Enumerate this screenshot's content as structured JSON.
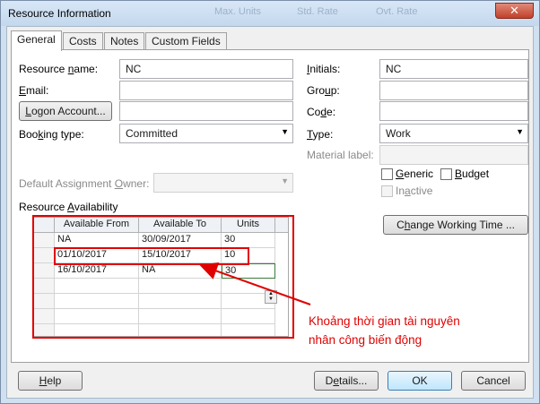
{
  "window": {
    "title": "Resource Information",
    "close_glyph": "✕",
    "background_texts": [
      "Max. Units",
      "Std. Rate",
      "Ovt. Rate"
    ]
  },
  "tabs": [
    {
      "label": "General",
      "active": true
    },
    {
      "label": "Costs",
      "active": false
    },
    {
      "label": "Notes",
      "active": false
    },
    {
      "label": "Custom Fields",
      "active": false
    }
  ],
  "left": {
    "resource_name": {
      "label_pre": "Resource ",
      "label_u": "n",
      "label_post": "ame:",
      "value": "NC"
    },
    "email": {
      "label_pre": "",
      "label_u": "E",
      "label_post": "mail:",
      "value": ""
    },
    "logon_button": {
      "label_pre": "",
      "label_u": "L",
      "label_post": "ogon Account..."
    },
    "logon_value": "",
    "booking": {
      "label_pre": "Boo",
      "label_u": "k",
      "label_post": "ing type:",
      "value": "Committed"
    },
    "default_owner": {
      "label_pre": "Default Assignment ",
      "label_u": "O",
      "label_post": "wner:",
      "value": ""
    }
  },
  "right": {
    "initials": {
      "label_pre": "",
      "label_u": "I",
      "label_post": "nitials:",
      "value": "NC"
    },
    "group": {
      "label_pre": "Gro",
      "label_u": "u",
      "label_post": "p:",
      "value": ""
    },
    "code": {
      "label_pre": "Co",
      "label_u": "d",
      "label_post": "e:",
      "value": ""
    },
    "type": {
      "label_pre": "",
      "label_u": "T",
      "label_post": "ype:",
      "value": "Work"
    },
    "material_label": {
      "label": "Material label:",
      "value": ""
    },
    "generic": {
      "label_pre": "",
      "label_u": "G",
      "label_post": "eneric",
      "checked": false
    },
    "budget": {
      "label_pre": "",
      "label_u": "B",
      "label_post": "udget",
      "checked": false
    },
    "inactive": {
      "label_pre": "In",
      "label_u": "a",
      "label_post": "ctive",
      "checked": false
    },
    "change_working_time": {
      "label_pre": "C",
      "label_u": "h",
      "label_post": "ange Working Time ..."
    }
  },
  "availability": {
    "section_pre": "Resource ",
    "section_u": "A",
    "section_post": "vailability",
    "columns": [
      "Available From",
      "Available To",
      "Units"
    ],
    "rows": [
      [
        "NA",
        "30/09/2017",
        "30"
      ],
      [
        "01/10/2017",
        "15/10/2017",
        "10"
      ],
      [
        "16/10/2017",
        "NA",
        "30"
      ],
      [
        "",
        "",
        ""
      ],
      [
        "",
        "",
        ""
      ],
      [
        "",
        "",
        ""
      ],
      [
        "",
        "",
        ""
      ]
    ]
  },
  "annotation": {
    "text": "Khoảng thời gian tài nguyên nhân công biến động",
    "color": "#e00000"
  },
  "footer": {
    "help": {
      "label_pre": "",
      "label_u": "H",
      "label_post": "elp"
    },
    "details": {
      "label_pre": "D",
      "label_u": "e",
      "label_post": "tails..."
    },
    "ok": "OK",
    "cancel": "Cancel"
  }
}
